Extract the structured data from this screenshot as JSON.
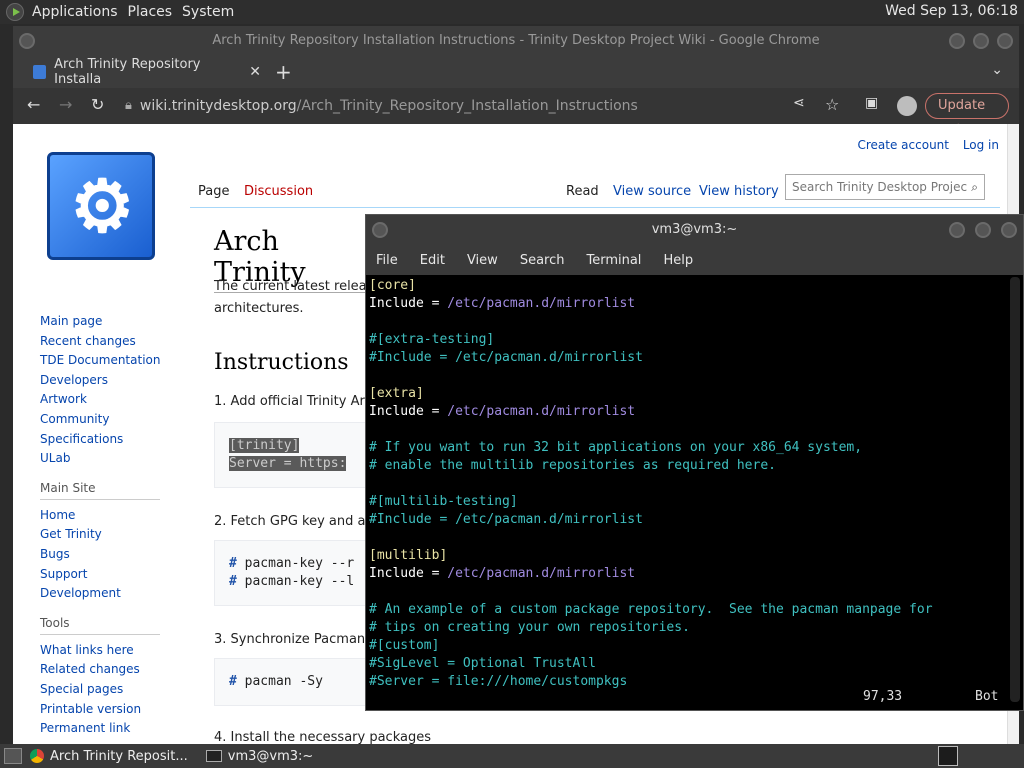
{
  "top_panel": {
    "menus": [
      "Applications",
      "Places",
      "System"
    ],
    "clock": "Wed Sep 13, 06:18"
  },
  "browser": {
    "window_title": "Arch Trinity Repository Installation Instructions - Trinity Desktop Project Wiki - Google Chrome",
    "tab_title": "Arch Trinity Repository Installa",
    "url_host": "wiki.trinitydesktop.org",
    "url_path": "/Arch_Trinity_Repository_Installation_Instructions",
    "update_label": "Update"
  },
  "wiki": {
    "create_account": "Create account",
    "log_in": "Log in",
    "tabs": {
      "page": "Page",
      "discussion": "Discussion",
      "read": "Read",
      "view_source": "View source",
      "view_history": "View history"
    },
    "search_placeholder": "Search Trinity Desktop Projec",
    "nav_links": [
      "Main page",
      "Recent changes",
      "TDE Documentation",
      "Developers",
      "Artwork",
      "Community",
      "Specifications",
      "ULab"
    ],
    "main_site_header": "Main Site",
    "main_site_links": [
      "Home",
      "Get Trinity",
      "Bugs",
      "Support",
      "Development"
    ],
    "tools_header": "Tools",
    "tools_links": [
      "What links here",
      "Related changes",
      "Special pages",
      "Printable version",
      "Permanent link"
    ],
    "heading": "Arch Trinity",
    "intro_line1": "The current latest releas",
    "intro_line2": "architectures.",
    "instructions_heading": "Instructions",
    "step1": "1. Add official Trinity Arch",
    "code1": [
      "[trinity]",
      "Server = https:"
    ],
    "step2": "2. Fetch GPG key and a",
    "code2": [
      "pacman-key --r",
      "pacman-key --l"
    ],
    "step3": "3. Synchronize Pacman",
    "code3": [
      "pacman -Sy"
    ],
    "step4": "4. Install the necessary packages"
  },
  "terminal": {
    "title": "vm3@vm3:~",
    "menu": [
      "File",
      "Edit",
      "View",
      "Search",
      "Terminal",
      "Help"
    ],
    "lines": [
      {
        "t": "section",
        "text": "[core]"
      },
      {
        "t": "kv",
        "key": "Include = ",
        "val": "/etc/pacman.d/mirrorlist"
      },
      {
        "t": "blank",
        "text": ""
      },
      {
        "t": "comment",
        "text": "#[extra-testing]"
      },
      {
        "t": "comment",
        "text": "#Include = /etc/pacman.d/mirrorlist"
      },
      {
        "t": "blank",
        "text": ""
      },
      {
        "t": "section",
        "text": "[extra]"
      },
      {
        "t": "kv",
        "key": "Include = ",
        "val": "/etc/pacman.d/mirrorlist"
      },
      {
        "t": "blank",
        "text": ""
      },
      {
        "t": "comment",
        "text": "# If you want to run 32 bit applications on your x86_64 system,"
      },
      {
        "t": "comment",
        "text": "# enable the multilib repositories as required here."
      },
      {
        "t": "blank",
        "text": ""
      },
      {
        "t": "comment",
        "text": "#[multilib-testing]"
      },
      {
        "t": "comment",
        "text": "#Include = /etc/pacman.d/mirrorlist"
      },
      {
        "t": "blank",
        "text": ""
      },
      {
        "t": "section",
        "text": "[multilib]"
      },
      {
        "t": "kv",
        "key": "Include = ",
        "val": "/etc/pacman.d/mirrorlist"
      },
      {
        "t": "blank",
        "text": ""
      },
      {
        "t": "comment",
        "text": "# An example of a custom package repository.  See the pacman manpage for"
      },
      {
        "t": "comment",
        "text": "# tips on creating your own repositories."
      },
      {
        "t": "comment",
        "text": "#[custom]"
      },
      {
        "t": "comment",
        "text": "#SigLevel = Optional TrustAll"
      },
      {
        "t": "comment",
        "text": "#Server = file:///home/custompkgs"
      }
    ],
    "cursor_pos": "97,33",
    "scroll_pos": "Bot"
  },
  "taskbar": {
    "tasks": [
      "Arch Trinity Reposit...",
      "vm3@vm3:~"
    ]
  }
}
